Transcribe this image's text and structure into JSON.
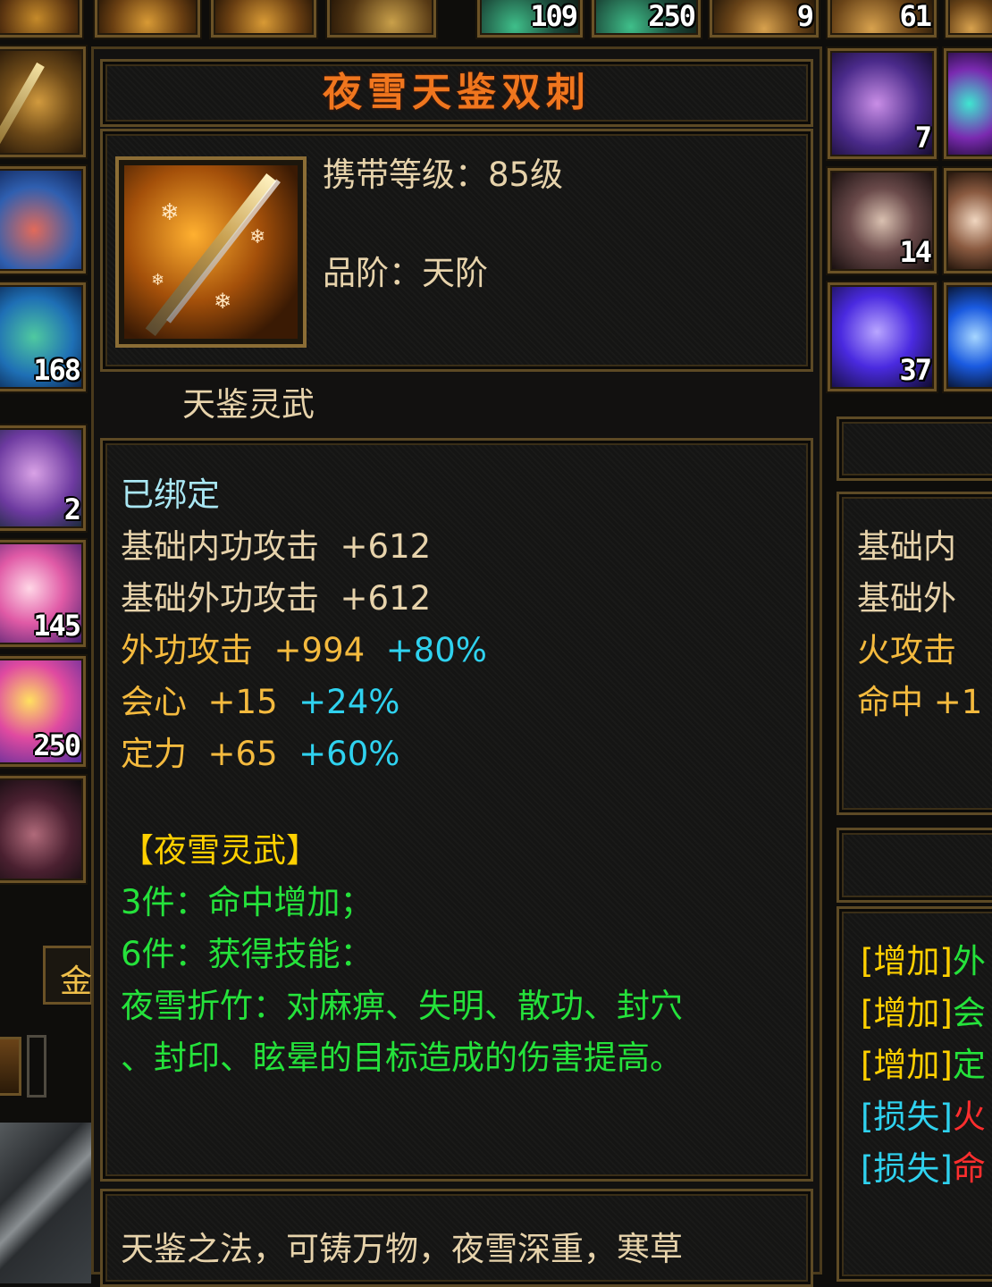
{
  "top_bar": {
    "counts": [
      "109",
      "250",
      "9",
      "61"
    ]
  },
  "left_column": {
    "counts": [
      "168",
      "2",
      "145",
      "250"
    ],
    "side_label": "金"
  },
  "right_column": {
    "counts": [
      "7",
      "14",
      "37"
    ]
  },
  "tooltip": {
    "title": "夜雪天鉴双刺",
    "carry_level": "携带等级：85级",
    "grade": "品阶：天阶",
    "category": "天鉴灵武",
    "bound": "已绑定",
    "stats": [
      {
        "name": "基础内功攻击",
        "value": "+612",
        "bonus": ""
      },
      {
        "name": "基础外功攻击",
        "value": "+612",
        "bonus": ""
      },
      {
        "name": "外功攻击",
        "value": "+994",
        "bonus": "+80%"
      },
      {
        "name": "会心",
        "value": "+15",
        "bonus": "+24%"
      },
      {
        "name": "定力",
        "value": "+65",
        "bonus": "+60%"
      }
    ],
    "set_name": "【夜雪灵武】",
    "set_bonus_3": "3件：命中增加；",
    "set_bonus_6": "6件：获得技能：",
    "skill_line_1": "夜雪折竹：对麻痹、失明、散功、封穴",
    "skill_line_2": "、封印、眩晕的目标造成的伤害提高。",
    "description": "天鉴之法，可铸万物，夜雪深重，寒草"
  },
  "compare_panel": {
    "stats": [
      "基础内",
      "基础外",
      "火攻击",
      "命中  +1"
    ],
    "changes": [
      {
        "tag": "[增加]",
        "text": "外"
      },
      {
        "tag": "[增加]",
        "text": "会"
      },
      {
        "tag": "[增加]",
        "text": "定"
      },
      {
        "tag": "[损失]",
        "text": "火"
      },
      {
        "tag": "[损失]",
        "text": "命"
      }
    ]
  },
  "colors": {
    "title": "#f0761e",
    "stat_base": "#e7d3ab",
    "stat_gold": "#f4ba3e",
    "bonus_cyan": "#2fd2ef",
    "set_green": "#25e23b",
    "loss_red": "#ff2e2e"
  }
}
